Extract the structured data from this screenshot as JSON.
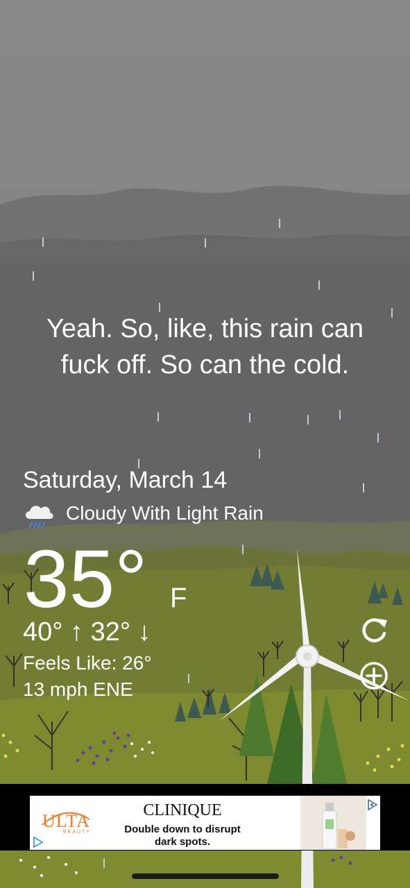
{
  "quote": {
    "line1": "Yeah. So, like, this rain can",
    "line2": "fuck off. So can the cold."
  },
  "weather": {
    "date": "Saturday, March 14",
    "condition": "Cloudy With Light Rain",
    "condition_icon": "cloud-rain-icon",
    "temperature": "35°",
    "unit": "F",
    "hi_lo": "40° ↑  32° ↓",
    "feels_like": "Feels Like: 26°",
    "wind": "13 mph ENE"
  },
  "actions": {
    "refresh_icon": "refresh-icon",
    "add_icon": "add-location-icon"
  },
  "ad": {
    "advertiser_logo": "ULTA",
    "advertiser_logo_sub": "BEAUTY",
    "brand": "CLINIQUE",
    "line1": "Double down to disrupt",
    "line2": "dark spots.",
    "choices_icon": "ad-choices-icon"
  },
  "colors": {
    "sky": "#7a7a7a",
    "grass": "#6f7a2e",
    "text": "#ffffff",
    "ulta_orange": "#f47a20"
  }
}
